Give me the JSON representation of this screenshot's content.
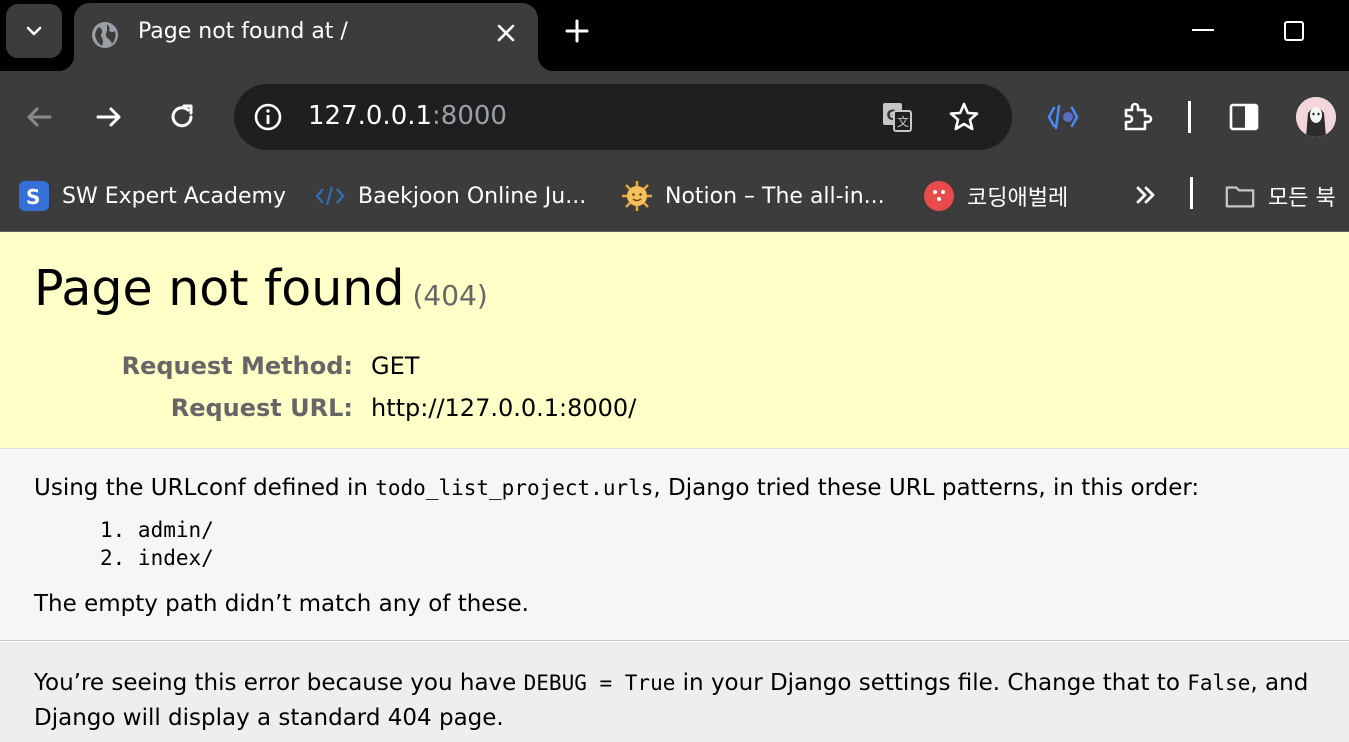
{
  "browser": {
    "tab": {
      "title": "Page not found at /"
    },
    "address": {
      "host": "127.0.0.1",
      "port": ":8000"
    },
    "bookmarks": [
      {
        "label": "SW Expert Academy",
        "icon": "sw-expert-logo-icon"
      },
      {
        "label": "Baekjoon Online Ju...",
        "icon": "code-brackets-icon"
      },
      {
        "label": "Notion – The all-in...",
        "icon": "sun-face-icon"
      },
      {
        "label": "코딩애벌레",
        "icon": "red-circle-icon"
      },
      {
        "label": "모든 북",
        "icon": "folder-icon"
      }
    ]
  },
  "page": {
    "heading": "Page not found",
    "status_code": "(404)",
    "request_method_label": "Request Method:",
    "request_method": "GET",
    "request_url_label": "Request URL:",
    "request_url": "http://127.0.0.1:8000/",
    "urlconf_prefix": "Using the URLconf defined in ",
    "urlconf_module": "todo_list_project.urls",
    "urlconf_suffix": ", Django tried these URL patterns, in this order:",
    "patterns": [
      "1. admin/",
      "2. index/"
    ],
    "no_match": "The empty path didn’t match any of these.",
    "explain_1": "You’re seeing this error because you have ",
    "explain_debug": "DEBUG = True",
    "explain_2": " in your Django settings file. Change that to ",
    "explain_false": "False",
    "explain_3": ", and Django will display a standard 404 page."
  }
}
